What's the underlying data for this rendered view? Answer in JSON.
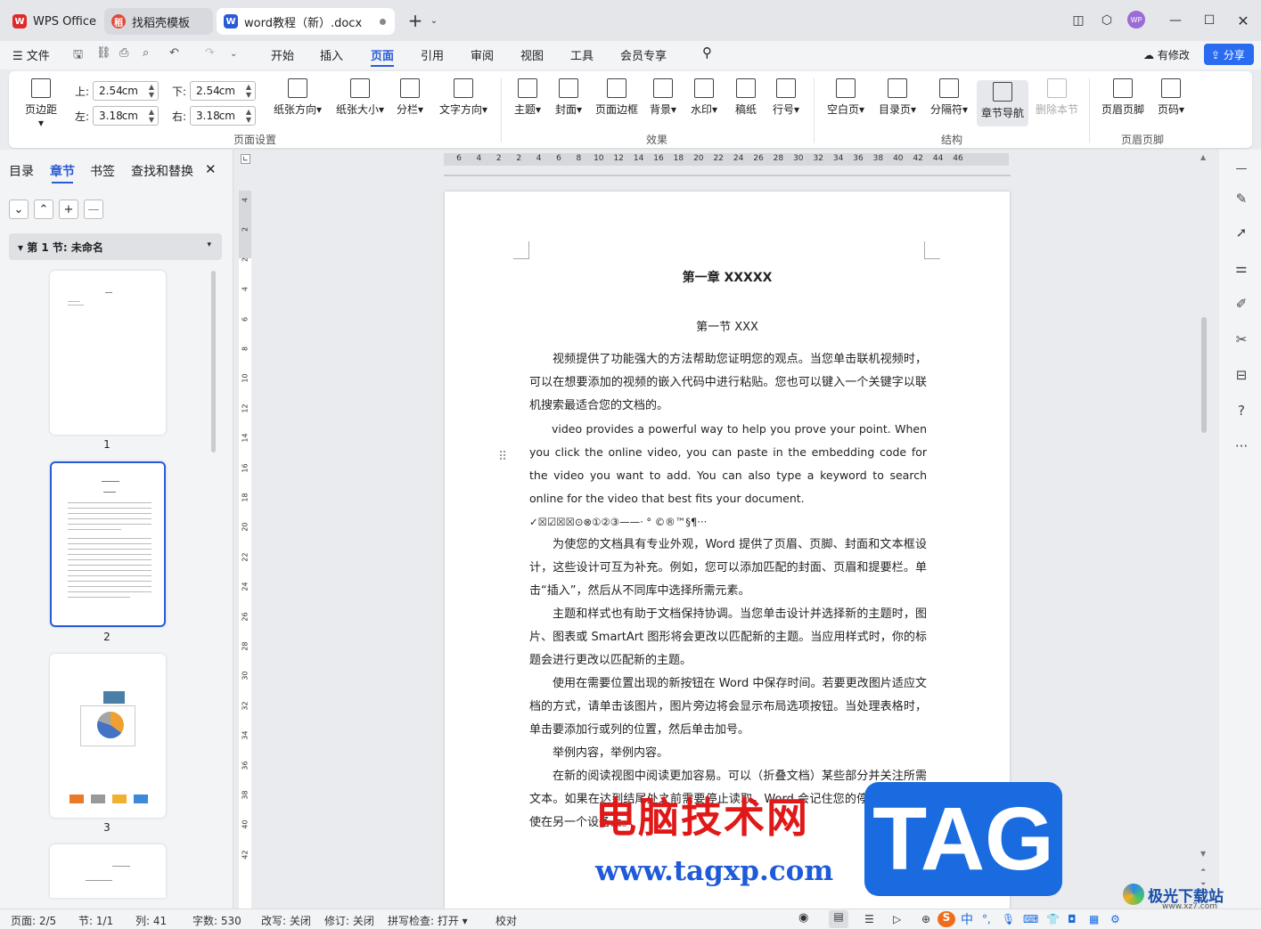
{
  "tabs": [
    {
      "label": "WPS Office"
    },
    {
      "label": "找稻壳模板"
    },
    {
      "label": "word教程（新）.docx"
    }
  ],
  "menu": {
    "file": "文件",
    "items": [
      "开始",
      "插入",
      "页面",
      "引用",
      "审阅",
      "视图",
      "工具",
      "会员专享"
    ],
    "active": "页面",
    "modified": "有修改",
    "share": "分享"
  },
  "ribbon": {
    "margins": "页边距",
    "top_label": "上:",
    "top": "2.54",
    "bottom_label": "下:",
    "bottom": "2.54",
    "left_label": "左:",
    "left": "3.18",
    "right_label": "右:",
    "right": "3.18",
    "unit": "cm",
    "page_setup": [
      "纸张方向",
      "纸张大小",
      "分栏",
      "文字方向"
    ],
    "effects": [
      "主题",
      "封面",
      "页面边框",
      "背景",
      "水印",
      "稿纸",
      "行号"
    ],
    "structure": [
      "空白页",
      "目录页",
      "分隔符",
      "章节导航",
      "删除本节"
    ],
    "headerfooter": [
      "页眉页脚",
      "页码"
    ],
    "groups": [
      "页面设置",
      "效果",
      "结构",
      "页眉页脚"
    ]
  },
  "left": {
    "tabs": [
      "目录",
      "章节",
      "书签",
      "查找和替换"
    ],
    "section": "第 1 节: 未命名",
    "pages": [
      "1",
      "2",
      "3"
    ]
  },
  "ruler_h": [
    "6",
    "4",
    "2",
    "2",
    "4",
    "6",
    "8",
    "10",
    "12",
    "14",
    "16",
    "18",
    "20",
    "22",
    "24",
    "26",
    "28",
    "30",
    "32",
    "34",
    "36",
    "38",
    "40",
    "42",
    "44",
    "46"
  ],
  "ruler_v": [
    "4",
    "2",
    "2",
    "4",
    "6",
    "8",
    "10",
    "12",
    "14",
    "16",
    "18",
    "20",
    "22",
    "24",
    "26",
    "28",
    "30",
    "32",
    "34",
    "36",
    "38",
    "40",
    "42"
  ],
  "doc": {
    "h1": "第一章  XXXXX",
    "h2": "第一节  XXX",
    "p1": "视频提供了功能强大的方法帮助您证明您的观点。当您单击联机视频时，可以在想要添加的视频的嵌入代码中进行粘贴。您也可以键入一个关键字以联机搜索最适合您的文档的。",
    "p2": "video provides a powerful way to help you prove your point. When you click the online video, you can paste in the embedding code for the video you want to add. You can also type a keyword to search online for the video that best fits your document.",
    "sym": "✓☒☑☒☒⊙⊗①②③——·  °  ©®™§¶···",
    "p3": "为使您的文档具有专业外观，Word 提供了页眉、页脚、封面和文本框设计，这些设计可互为补充。例如，您可以添加匹配的封面、页眉和提要栏。单击“插入”，然后从不同库中选择所需元素。",
    "p4": "主题和样式也有助于文档保持协调。当您单击设计并选择新的主题时，图片、图表或 SmartArt 图形将会更改以匹配新的主题。当应用样式时，你的标题会进行更改以匹配新的主题。",
    "p5": "使用在需要位置出现的新按钮在 Word 中保存时间。若要更改图片适应文档的方式，请单击该图片，图片旁边将会显示布局选项按钮。当处理表格时，单击要添加行或列的位置，然后单击加号。",
    "p6": "举例内容，举例内容。",
    "p7": "在新的阅读视图中阅读更加容易。可以（折叠文档）某些部分并关注所需文本。如果在达到结尾处之前需要停止读取，Word 会记住您的停止位置 - 即使在另一个设备上。"
  },
  "watermark": {
    "cn": "电脑技术网",
    "url": "www.tagxp.com",
    "tag": "TAG",
    "site": "极光下载站",
    "site_url": "www.xz7.com"
  },
  "status": {
    "page": "页面: 2/5",
    "section": "节: 1/1",
    "col": "列: 41",
    "words": "字数: 530",
    "overtype": "改写: 关闭",
    "revise": "修订: 关闭",
    "spell": "拼写检查: 打开",
    "proof": "校对"
  },
  "colors": {
    "accent": "#2a5bd7",
    "wps_red": "#e02a2a"
  }
}
